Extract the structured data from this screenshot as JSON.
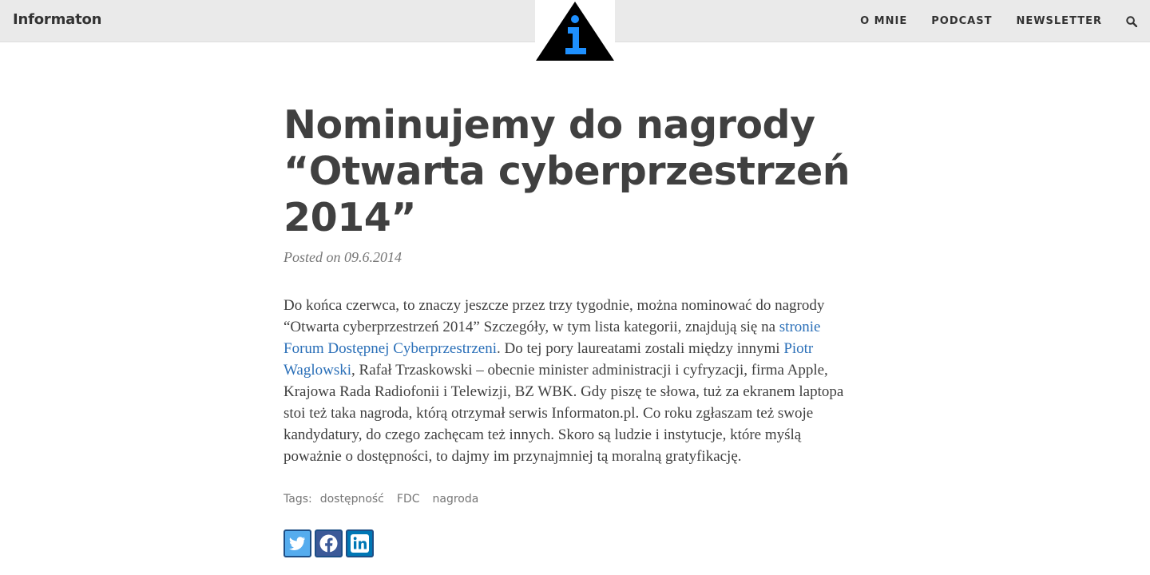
{
  "header": {
    "site_title": "Informaton",
    "nav": [
      "O MNIE",
      "PODCAST",
      "NEWSLETTER"
    ],
    "icons": {
      "logo": "info-triangle-logo",
      "search": "search-icon"
    }
  },
  "post": {
    "title": "Nominujemy do nagrody “Otwarta cyberprzestrzeń 2014”",
    "meta": "Posted on 09.6.2014",
    "body": {
      "p1": "Do końca czerwca, to znaczy jeszcze przez trzy tygodnie, można nominować do nagrody “Otwarta cyberprzestrzeń 2014” Szczegóły, w tym lista kategorii, znajdują się na ",
      "link1": "stronie Forum Dostępnej Cyberprzestrzeni",
      "p2": ". Do tej pory laureatami zostali między innymi ",
      "link2": "Piotr Waglowski",
      "p3": ", Rafał Trzaskowski – obecnie minister administracji i cyfryzacji, firma Apple, Krajowa Rada Radiofonii i Telewizji, BZ WBK. Gdy piszę te słowa, tuż za ekranem laptopa stoi też taka nagroda, którą otrzymał serwis Informaton.pl. Co roku zgłaszam też swoje kandydatury, do czego zachęcam też innych. Skoro są ludzie i instytucje, które myślą poważnie o dostępności, to dajmy im przynajmniej tą moralną gratyfikację."
    },
    "tags_label": "Tags:",
    "tags": [
      "dostępność",
      "FDC",
      "nagroda"
    ],
    "share": [
      "twitter-icon",
      "facebook-icon",
      "linkedin-icon"
    ]
  },
  "colors": {
    "header_bg": "#eaeaea",
    "text": "#404040",
    "link": "#2a6fb8",
    "meta": "#767676",
    "logo_accent": "#1e90ff",
    "twitter": "#55acee",
    "facebook": "#3b5998",
    "linkedin": "#0077b5"
  }
}
